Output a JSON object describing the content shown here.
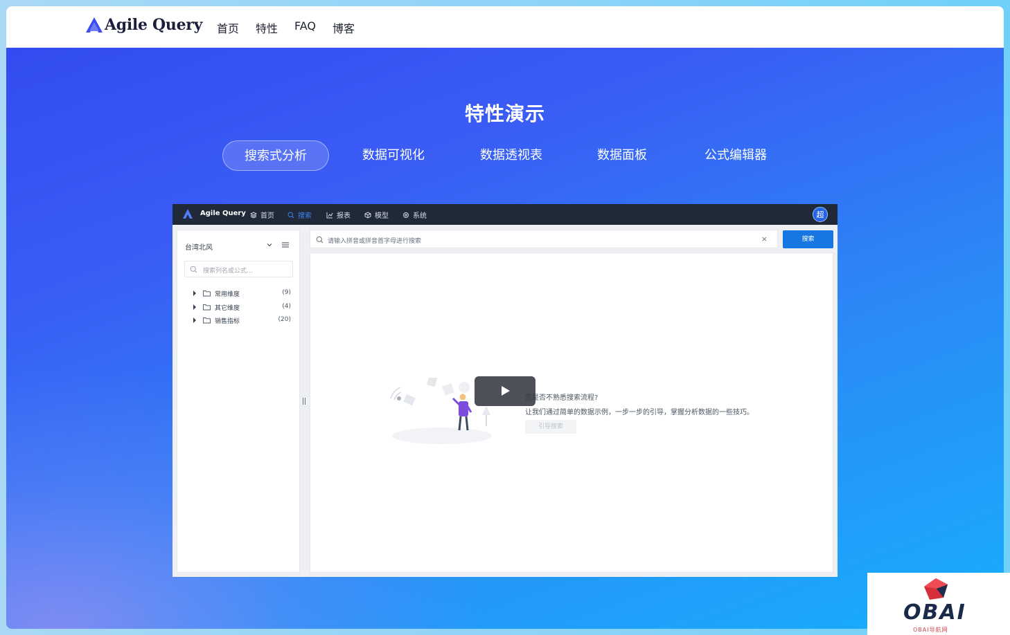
{
  "site": {
    "brand": "Agile Query",
    "nav": [
      "首页",
      "特性",
      "FAQ",
      "博客"
    ]
  },
  "hero": {
    "title": "特性演示",
    "tabs": [
      {
        "label": "搜索式分析",
        "active": true
      },
      {
        "label": "数据可视化",
        "active": false
      },
      {
        "label": "数据透视表",
        "active": false
      },
      {
        "label": "数据面板",
        "active": false
      },
      {
        "label": "公式编辑器",
        "active": false
      }
    ]
  },
  "demo": {
    "app_name": "Agile Query",
    "menu": [
      {
        "label": "首页",
        "icon": "layers-icon",
        "active": false
      },
      {
        "label": "搜索",
        "icon": "search-icon",
        "active": true
      },
      {
        "label": "报表",
        "icon": "chart-icon",
        "active": false
      },
      {
        "label": "模型",
        "icon": "cube-icon",
        "active": false
      },
      {
        "label": "系统",
        "icon": "gear-icon",
        "active": false
      }
    ],
    "avatar": "超",
    "sidebar": {
      "title": "台湾北风",
      "search_placeholder": "搜索列名或公式...",
      "tree": [
        {
          "label": "常用维度",
          "count": "(9)"
        },
        {
          "label": "其它维度",
          "count": "(4)"
        },
        {
          "label": "销售指标",
          "count": "(20)"
        }
      ]
    },
    "search": {
      "placeholder": "请输入拼音或拼音首字母进行搜索",
      "clear": "×",
      "button": "搜索"
    },
    "empty": {
      "title": "您是否不熟悉搜索流程?",
      "desc": "让我们通过简单的数据示例，一步一步的引导，掌握分析数据的一些技巧。",
      "button": "引导搜索"
    },
    "video": {
      "icon": "play-icon"
    }
  },
  "watermark": {
    "text": "OBAI",
    "sub": "OBAI导航网"
  },
  "colors": {
    "accent": "#1677e3",
    "app_bar": "#1f2937",
    "brand_blue": "#3b5bf0"
  }
}
